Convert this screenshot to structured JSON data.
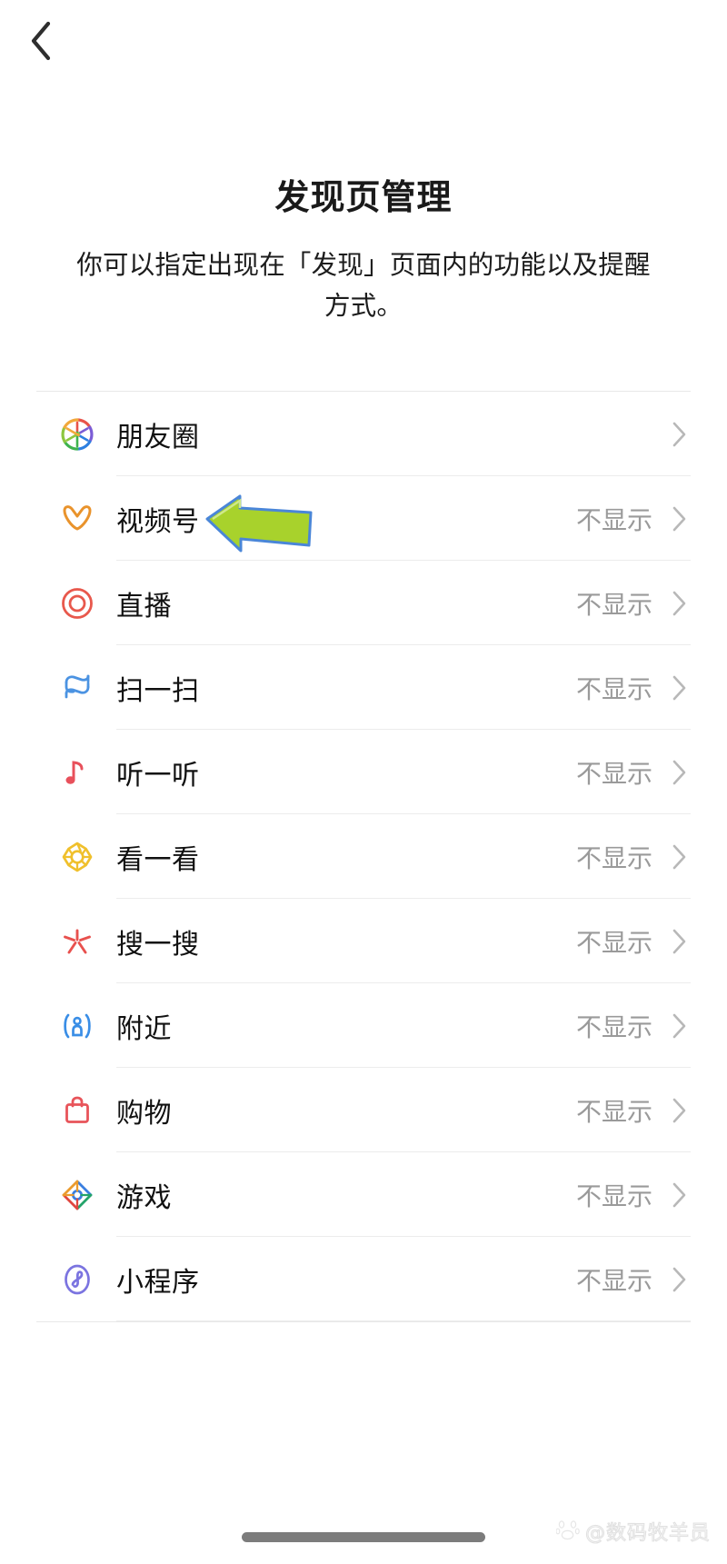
{
  "navbar": {
    "back_icon": "chevron-left-icon"
  },
  "header": {
    "title": "发现页管理",
    "subtitle": "你可以指定出现在「发现」页面内的功能以及提醒方式。"
  },
  "list": {
    "status_not_shown": "不显示",
    "chevron_icon": "chevron-right-icon",
    "items": [
      {
        "label": "朋友圈",
        "status": "",
        "icon": "moments-aperture-icon"
      },
      {
        "label": "视频号",
        "status": "不显示",
        "icon": "channels-icon"
      },
      {
        "label": "直播",
        "status": "不显示",
        "icon": "live-circle-icon"
      },
      {
        "label": "扫一扫",
        "status": "不显示",
        "icon": "scan-icon"
      },
      {
        "label": "听一听",
        "status": "不显示",
        "icon": "music-note-icon"
      },
      {
        "label": "看一看",
        "status": "不显示",
        "icon": "top-stories-flower-icon"
      },
      {
        "label": "搜一搜",
        "status": "不显示",
        "icon": "search-starburst-icon"
      },
      {
        "label": "附近",
        "status": "不显示",
        "icon": "nearby-person-icon"
      },
      {
        "label": "购物",
        "status": "不显示",
        "icon": "shopping-bag-icon"
      },
      {
        "label": "游戏",
        "status": "不显示",
        "icon": "games-diamond-icon"
      },
      {
        "label": "小程序",
        "status": "不显示",
        "icon": "mini-program-icon"
      }
    ]
  },
  "annotation": {
    "arrow_icon": "green-pointer-arrow",
    "arrow_fill": "#a8d22c",
    "arrow_stroke": "#4a86d8",
    "points_at": "视频号"
  },
  "watermark": {
    "text": "@数码牧羊员",
    "logo_icon": "baidu-paw-icon"
  },
  "colors": {
    "background": "#ffffff",
    "title": "#1a1a1a",
    "label": "#111111",
    "status": "#9a9a9a",
    "separator": "#ececec",
    "chevron": "#b8b8b8",
    "home_indicator": "#7c7c7c"
  }
}
